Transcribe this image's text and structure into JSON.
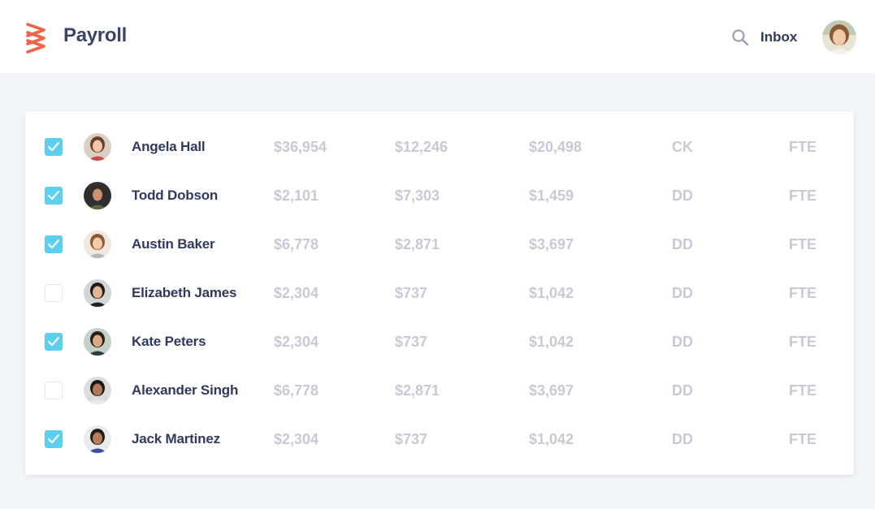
{
  "header": {
    "title": "Payroll",
    "inbox_label": "Inbox",
    "logo_icon": "stacked-chevrons-logo-icon",
    "brand_color": "#f06449"
  },
  "colors": {
    "checkbox_checked": "#5ed0ee",
    "name_text": "#2f3a5e",
    "muted_text": "#c5cad6"
  },
  "employees": [
    {
      "name": "Angela Hall",
      "checked": true,
      "col1": "$36,954",
      "col2": "$12,246",
      "col3": "$20,498",
      "method": "CK",
      "type": "FTE"
    },
    {
      "name": "Todd Dobson",
      "checked": true,
      "col1": "$2,101",
      "col2": "$7,303",
      "col3": "$1,459",
      "method": "DD",
      "type": "FTE"
    },
    {
      "name": "Austin Baker",
      "checked": true,
      "col1": "$6,778",
      "col2": "$2,871",
      "col3": "$3,697",
      "method": "DD",
      "type": "FTE"
    },
    {
      "name": "Elizabeth James",
      "checked": false,
      "col1": "$2,304",
      "col2": "$737",
      "col3": "$1,042",
      "method": "DD",
      "type": "FTE"
    },
    {
      "name": "Kate Peters",
      "checked": true,
      "col1": "$2,304",
      "col2": "$737",
      "col3": "$1,042",
      "method": "DD",
      "type": "FTE"
    },
    {
      "name": "Alexander Singh",
      "checked": false,
      "col1": "$6,778",
      "col2": "$2,871",
      "col3": "$3,697",
      "method": "DD",
      "type": "FTE"
    },
    {
      "name": "Jack Martinez",
      "checked": true,
      "col1": "$2,304",
      "col2": "$737",
      "col3": "$1,042",
      "method": "DD",
      "type": "FTE"
    }
  ]
}
